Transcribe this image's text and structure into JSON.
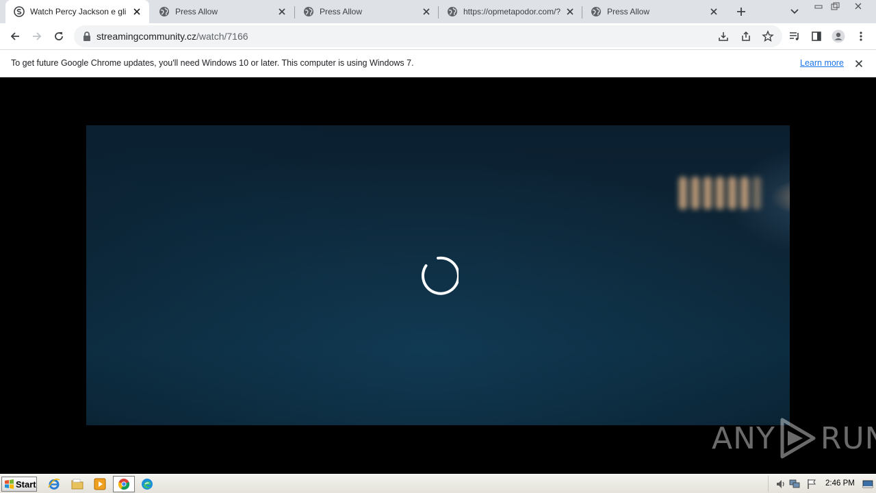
{
  "tabs": [
    {
      "label": "Watch Percy Jackson e gli dei dell'Olimpo",
      "icon": "streamingcommunity-favicon",
      "active": true
    },
    {
      "label": "Press Allow",
      "icon": "globe-icon",
      "active": false
    },
    {
      "label": "Press Allow",
      "icon": "globe-icon",
      "active": false
    },
    {
      "label": "https://opmetapodor.com/?s=",
      "icon": "globe-icon",
      "active": false
    },
    {
      "label": "Press Allow",
      "icon": "globe-icon",
      "active": false
    }
  ],
  "address_bar": {
    "domain": "streamingcommunity.cz",
    "path": "/watch/7166"
  },
  "infobar": {
    "message": "To get future Google Chrome updates, you'll need Windows 10 or later. This computer is using Windows 7.",
    "link": "Learn more"
  },
  "watermark": {
    "left": "ANY",
    "right": "RUN"
  },
  "taskbar": {
    "start_label": "Start",
    "clock": "2:46 PM"
  },
  "colors": {
    "tabstrip": "#dee1e6",
    "link": "#1a73e8",
    "video_bg": "#0c2536"
  }
}
